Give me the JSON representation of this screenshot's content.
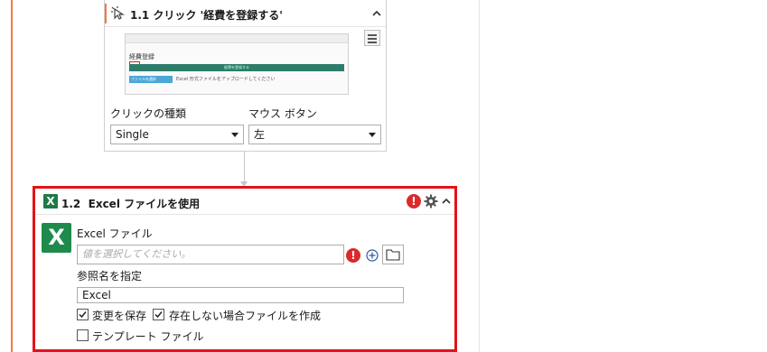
{
  "click_activity": {
    "title": "1.1 クリック '経費を登録する'",
    "preview": {
      "heading": "経費登録",
      "green_bar_text": "経費を登録する",
      "blue_button_text": "ファイルを選択",
      "note_text": "Excel 形式ファイルをアップロードしてください"
    },
    "click_type": {
      "label": "クリックの種類",
      "value": "Single"
    },
    "mouse_button": {
      "label": "マウス ボタン",
      "value": "左"
    }
  },
  "excel_activity": {
    "title_number": "1.2",
    "title": "Excel ファイルを使用",
    "file_field": {
      "label": "Excel ファイル",
      "placeholder": "値を選択してください。"
    },
    "reference_field": {
      "label": "参照名を指定",
      "value": "Excel"
    },
    "checkboxes": [
      {
        "label": "変更を保存",
        "checked": true
      },
      {
        "label": "存在しない場合ファイルを作成",
        "checked": true
      },
      {
        "label": "テンプレート ファイル",
        "checked": false
      }
    ]
  },
  "colors": {
    "accent_orange": "#f07b4a",
    "error_red": "#e2131b",
    "excel_green": "#1f7a45"
  },
  "icons": [
    "click-icon",
    "chevron-up-icon",
    "hamburger-menu-icon",
    "dropdown-caret-icon",
    "excel-icon",
    "error-icon",
    "gear-icon",
    "plus-circle-icon",
    "folder-icon",
    "checkmark-icon"
  ]
}
